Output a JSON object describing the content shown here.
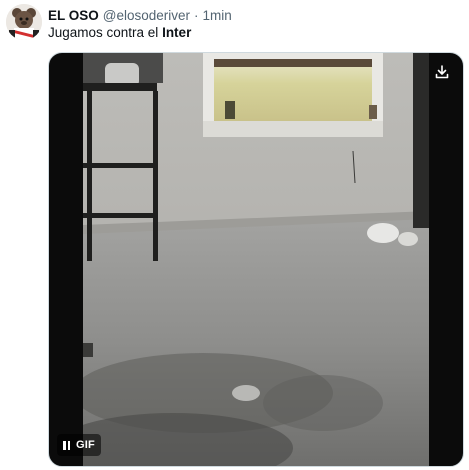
{
  "tweet": {
    "display_name": "EL OSO",
    "handle": "@elosoderiver",
    "separator": "·",
    "time": "1min",
    "text_prefix": "Jugamos contra el ",
    "text_bold": "Inter"
  },
  "media": {
    "badge": "GIF",
    "controls": [
      "pause-icon",
      "download-icon"
    ]
  },
  "colors": {
    "secondary_text": "#536471",
    "primary_text": "#0f1419",
    "carpet": "#8f8f8f",
    "wall": "#b9b9b6"
  }
}
